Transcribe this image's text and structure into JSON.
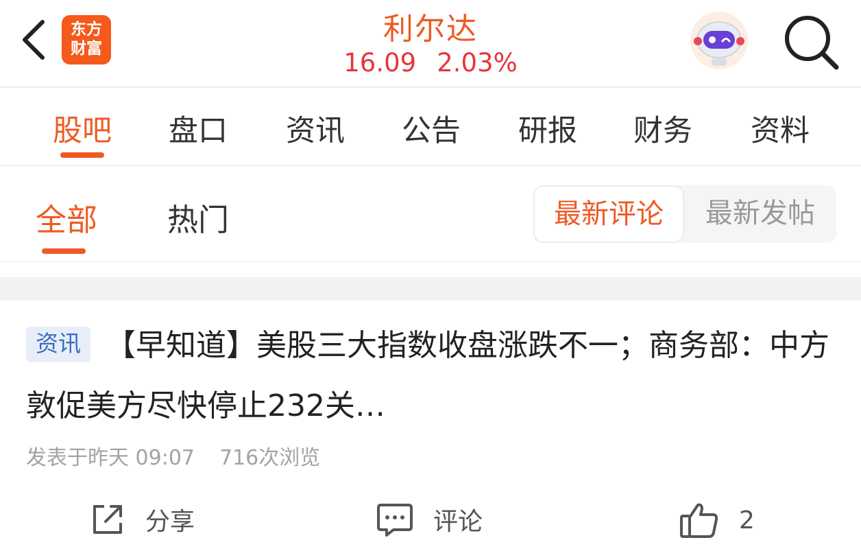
{
  "header": {
    "back_icon": "chevron-left-icon",
    "logo_line1": "东方",
    "logo_line2": "财富",
    "stock_name": "利尔达",
    "price": "16.09",
    "change_pct": "2.03%",
    "assistant_icon": "robot-assistant-icon",
    "search_icon": "search-icon",
    "colors": {
      "brand": "#ee5a24",
      "up": "#e8343c"
    }
  },
  "main_tabs": [
    {
      "label": "股吧",
      "active": true
    },
    {
      "label": "盘口"
    },
    {
      "label": "资讯"
    },
    {
      "label": "公告"
    },
    {
      "label": "研报"
    },
    {
      "label": "财务"
    },
    {
      "label": "资料"
    }
  ],
  "sub_tabs": [
    {
      "label": "全部",
      "active": true
    },
    {
      "label": "热门"
    }
  ],
  "sort": {
    "latest_comment": "最新评论",
    "latest_post": "最新发帖",
    "selected": "最新评论"
  },
  "post": {
    "badge": "资讯",
    "title": "【早知道】美股三大指数收盘涨跌不一；商务部：中方敦促美方尽快停止232关…",
    "time": "发表于昨天 09:07",
    "views": "716次浏览",
    "share_label": "分享",
    "comment_label": "评论",
    "like_count": "2"
  }
}
